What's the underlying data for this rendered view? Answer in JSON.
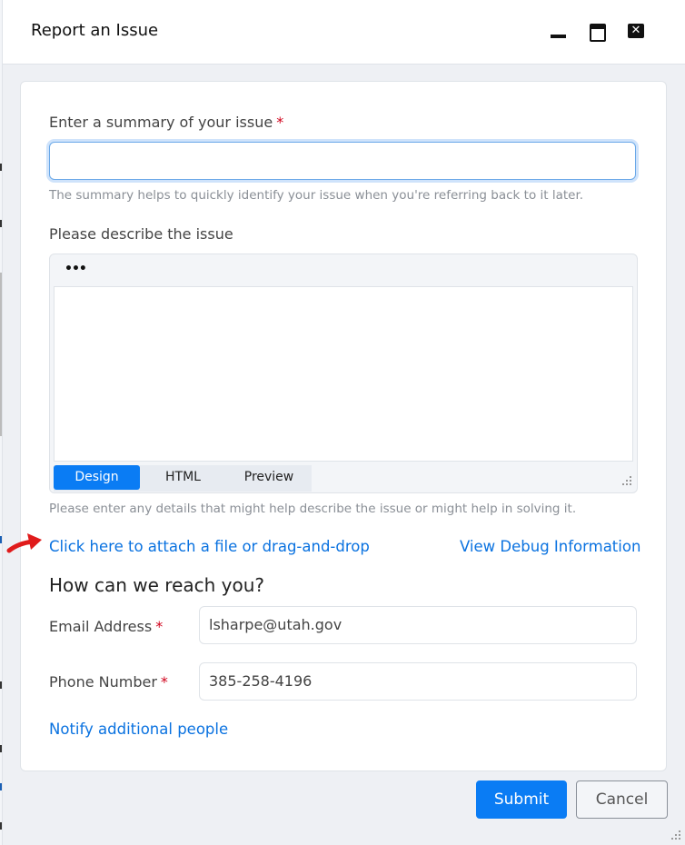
{
  "dialog": {
    "title": "Report an Issue",
    "window_controls": [
      "minimize-icon",
      "maximize-icon",
      "close-icon"
    ],
    "close_glyph": "✕"
  },
  "summary": {
    "label": "Enter a summary of your issue",
    "required_mark": "*",
    "value": "",
    "help": "The summary helps to quickly identify your issue when you're referring back to it later."
  },
  "description": {
    "label": "Please describe the issue",
    "toolbar_more": "•••",
    "tabs": [
      {
        "label": "Design",
        "active": true
      },
      {
        "label": "HTML",
        "active": false
      },
      {
        "label": "Preview",
        "active": false
      }
    ],
    "help": "Please enter any details that might help describe the issue or might help in solving it."
  },
  "links": {
    "attach": "Click here to attach a file or drag-and-drop",
    "debug": "View Debug Information",
    "notify": "Notify additional people"
  },
  "contact": {
    "heading": "How can we reach you?",
    "email_label": "Email Address",
    "email_value": "lsharpe@utah.gov",
    "phone_label": "Phone Number",
    "phone_value": "385-258-4196",
    "required_mark": "*"
  },
  "buttons": {
    "submit": "Submit",
    "cancel": "Cancel"
  },
  "colors": {
    "accent": "#0a7cf4",
    "link": "#0a72e0",
    "required": "#d0021b",
    "annotation_arrow": "#e01b1b"
  }
}
